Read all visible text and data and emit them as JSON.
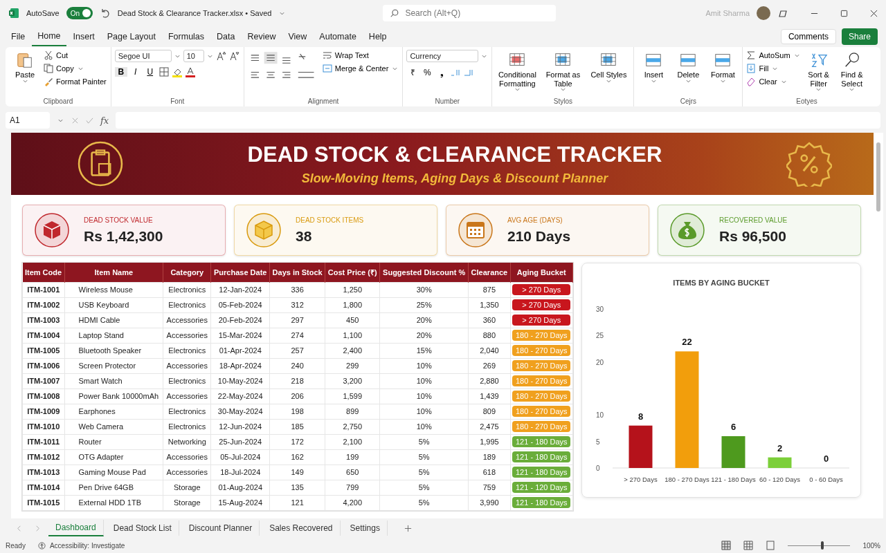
{
  "titlebar": {
    "autosave_label": "AutoSave",
    "autosave_on": true,
    "autosave_state": "On",
    "file_status": "Dead Stock & Clearance Tracker.xlsx • Saved",
    "search_placeholder": "Search (Alt+Q)",
    "user_name": "Amit Sharma"
  },
  "menu_tabs": [
    {
      "label": "File",
      "selected": false
    },
    {
      "label": "Home",
      "selected": true
    },
    {
      "label": "Insert",
      "selected": false
    },
    {
      "label": "Page Layout",
      "selected": false
    },
    {
      "label": "Formulas",
      "selected": false
    },
    {
      "label": "Data",
      "selected": false
    },
    {
      "label": "Review",
      "selected": false
    },
    {
      "label": "View",
      "selected": false
    },
    {
      "label": "Automate",
      "selected": false
    },
    {
      "label": "Help",
      "selected": false
    }
  ],
  "comments_button": "Comments",
  "share_button": "Share",
  "ribbon": {
    "clipboard": {
      "paste": "Paste",
      "cut": "Cut",
      "copy": "Copy",
      "format_painter": "Format Painter",
      "label": "Clipboard"
    },
    "font": {
      "font_name": "Segoe UI",
      "font_size": "10",
      "bold": "B",
      "italic": "I",
      "underline": "U",
      "label": "Font"
    },
    "alignment": {
      "wrap_text": "Wrap Text",
      "merge_center": "Merge & Center",
      "label": "Alignment"
    },
    "number": {
      "format": "Currency",
      "currency_symbol": "₹",
      "percent": "%",
      "comma": "❟",
      "label": "Number"
    },
    "styles": {
      "buttons": [
        "Conditional Formatting",
        "Format as Table",
        "Cell Styles"
      ],
      "label": "Stylos"
    },
    "cells": {
      "buttons": [
        "Insert",
        "Delete",
        "Format"
      ],
      "label": "Cejrs"
    },
    "editing": {
      "autosum": "AutoSum",
      "fill": "Fill",
      "clear": "Clear",
      "sort_filter": "Sort & Filter",
      "find_select": "Find & Select",
      "label": "Eotyes"
    }
  },
  "formula_bar": {
    "name_box": "A1",
    "fx": "fx"
  },
  "banner": {
    "title": "DEAD STOCK & CLEARANCE TRACKER",
    "subtitle": "Slow-Moving Items, Aging Days & Discount Planner"
  },
  "kpis": [
    {
      "label": "DEAD STOCK VALUE",
      "value": "Rs 1,42,300",
      "color": "#c0282d"
    },
    {
      "label": "DEAD STOCK ITEMS",
      "value": "38",
      "color": "#d99a0e"
    },
    {
      "label": "AVG AGE (DAYS)",
      "value": "210 Days",
      "color": "#c9761a"
    },
    {
      "label": "RECOVERED VALUE",
      "value": "Rs 96,500",
      "color": "#5a9a2a"
    }
  ],
  "table": {
    "columns": [
      "Item Code",
      "Item Name",
      "Category",
      "Purchase Date",
      "Days in Stock",
      "Cost Price (₹)",
      "Suggested Discount %",
      "Clearance",
      "Aging Bucket"
    ],
    "rows": [
      {
        "cells": [
          "ITM-1001",
          "Wireless Mouse",
          "Electronics",
          "12-Jan-2024",
          "336",
          "1,250",
          "30%",
          "875"
        ],
        "bucket": "> 270 Days",
        "color": "#c8161d"
      },
      {
        "cells": [
          "ITM-1002",
          "USB Keyboard",
          "Electronics",
          "05-Feb-2024",
          "312",
          "1,800",
          "25%",
          "1,350"
        ],
        "bucket": "> 270 Days",
        "color": "#c8161d"
      },
      {
        "cells": [
          "ITM-1003",
          "HDMI Cable",
          "Accessories",
          "20-Feb-2024",
          "297",
          "450",
          "20%",
          "360"
        ],
        "bucket": "> 270 Days",
        "color": "#c8161d"
      },
      {
        "cells": [
          "ITM-1004",
          "Laptop Stand",
          "Accessories",
          "15-Mar-2024",
          "274",
          "1,100",
          "20%",
          "880"
        ],
        "bucket": "180 - 270 Days",
        "color": "#f0a01e"
      },
      {
        "cells": [
          "ITM-1005",
          "Bluetooth Speaker",
          "Electronics",
          "01-Apr-2024",
          "257",
          "2,400",
          "15%",
          "2,040"
        ],
        "bucket": "180 - 270 Days",
        "color": "#f0a01e"
      },
      {
        "cells": [
          "ITM-1006",
          "Screen Protector",
          "Accessories",
          "18-Apr-2024",
          "240",
          "299",
          "10%",
          "269"
        ],
        "bucket": "180 - 270 Days",
        "color": "#f0a01e"
      },
      {
        "cells": [
          "ITM-1007",
          "Smart Watch",
          "Electronics",
          "10-May-2024",
          "218",
          "3,200",
          "10%",
          "2,880"
        ],
        "bucket": "180 - 270 Days",
        "color": "#f0a01e"
      },
      {
        "cells": [
          "ITM-1008",
          "Power Bank 10000mAh",
          "Accessories",
          "22-May-2024",
          "206",
          "1,599",
          "10%",
          "1,439"
        ],
        "bucket": "180 - 270 Days",
        "color": "#f0a01e"
      },
      {
        "cells": [
          "ITM-1009",
          "Earphones",
          "Electronics",
          "30-May-2024",
          "198",
          "899",
          "10%",
          "809"
        ],
        "bucket": "180 - 270 Days",
        "color": "#f0a01e"
      },
      {
        "cells": [
          "ITM-1010",
          "Web Camera",
          "Electronics",
          "12-Jun-2024",
          "185",
          "2,750",
          "10%",
          "2,475"
        ],
        "bucket": "180 - 270 Days",
        "color": "#f0a01e"
      },
      {
        "cells": [
          "ITM-1011",
          "Router",
          "Networking",
          "25-Jun-2024",
          "172",
          "2,100",
          "5%",
          "1,995"
        ],
        "bucket": "121 - 180 Days",
        "color": "#6aad3a"
      },
      {
        "cells": [
          "ITM-1012",
          "OTG Adapter",
          "Accessories",
          "05-Jul-2024",
          "162",
          "199",
          "5%",
          "189"
        ],
        "bucket": "121 - 180 Days",
        "color": "#6aad3a"
      },
      {
        "cells": [
          "ITM-1013",
          "Gaming Mouse Pad",
          "Accessories",
          "18-Jul-2024",
          "149",
          "650",
          "5%",
          "618"
        ],
        "bucket": "121 - 180 Days",
        "color": "#6aad3a"
      },
      {
        "cells": [
          "ITM-1014",
          "Pen Drive 64GB",
          "Storage",
          "01-Aug-2024",
          "135",
          "799",
          "5%",
          "759"
        ],
        "bucket": "121 - 120 Days",
        "color": "#6aad3a"
      },
      {
        "cells": [
          "ITM-1015",
          "External HDD 1TB",
          "Storage",
          "15-Aug-2024",
          "121",
          "4,200",
          "5%",
          "3,990"
        ],
        "bucket": "121 - 180 Days",
        "color": "#6aad3a"
      }
    ]
  },
  "chart": {
    "chart_data": {
      "type": "bar",
      "title": "ITEMS BY AGING BUCKET",
      "categories": [
        "> 270 Days",
        "180 - 270 Days",
        "121 - 180 Days",
        "60 - 120 Days",
        "0 - 60 Days"
      ],
      "series": [
        {
          "color": "#b5121b",
          "values": [
            8,
            null,
            null,
            null,
            null
          ]
        },
        {
          "color": "#f29e0c",
          "values": [
            null,
            22,
            null,
            null,
            null
          ]
        },
        {
          "color": "#4e9a1e",
          "values": [
            null,
            null,
            6,
            null,
            null
          ]
        },
        {
          "color": "#7ccf3a",
          "values": [
            null,
            null,
            null,
            2,
            null
          ]
        },
        {
          "values": [
            null,
            null,
            null,
            null,
            0
          ]
        }
      ],
      "stacked": true,
      "ylim": [
        0,
        30
      ],
      "yticks": [
        0,
        5,
        10,
        20,
        25,
        30
      ],
      "data_labels": true
    }
  },
  "sheet_tabs": [
    {
      "label": "Dashboard",
      "selected": true
    },
    {
      "label": "Dead Stock List",
      "selected": false
    },
    {
      "label": "Discount Planner",
      "selected": false
    },
    {
      "label": "Sales Recovered",
      "selected": false
    },
    {
      "label": "Settings",
      "selected": false
    }
  ],
  "status_bar": {
    "ready": "Ready",
    "accessibility": "Accessibility: Investigate",
    "zoom_slider": {
      "level": 0.55
    },
    "zoom": "100%"
  }
}
